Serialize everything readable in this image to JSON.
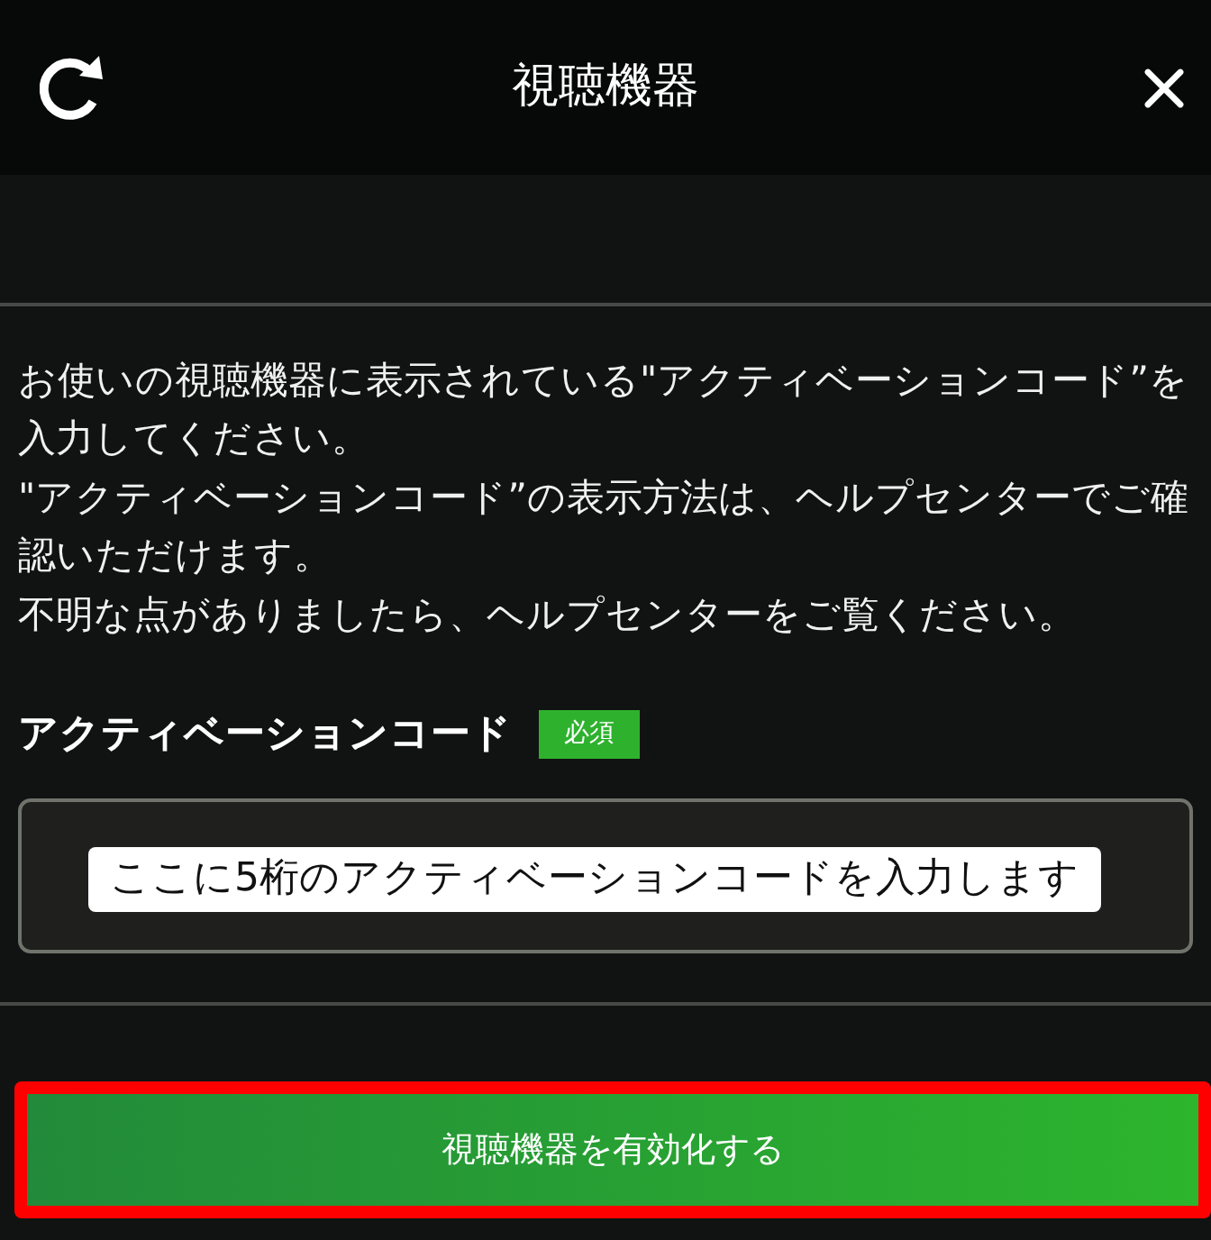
{
  "header": {
    "title": "視聴機器"
  },
  "instructions": [
    "お使いの視聴機器に表示されている\"アクティベーションコード”を入力してください。",
    "\"アクティベーションコード”の表示方法は、ヘルプセンターでご確認いただけます。",
    "不明な点がありましたら、ヘルプセンターをご覧ください。"
  ],
  "code_field": {
    "label": "アクティベーションコード",
    "badge": "必須",
    "annotation": "ここに5桁のアクティベーションコードを入力します"
  },
  "submit_button": {
    "label": "視聴機器を有効化する",
    "highlighted": true
  }
}
